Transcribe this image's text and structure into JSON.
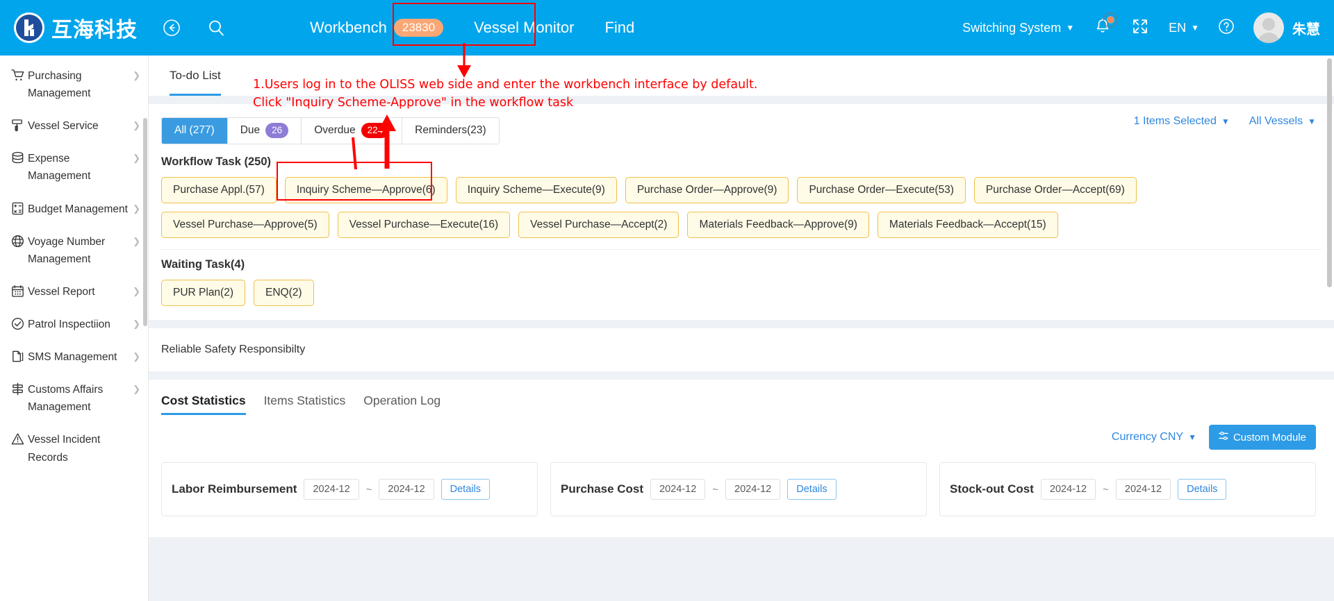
{
  "header": {
    "logo_text": "互海科技",
    "back_icon": "back-arrow-icon",
    "search_icon": "search-icon",
    "nav": [
      {
        "label": "Workbench",
        "badge": "23830",
        "highlighted": true
      },
      {
        "label": "Vessel Monitor",
        "badge": ""
      },
      {
        "label": "Find",
        "badge": ""
      }
    ],
    "switching_system": "Switching System",
    "language": "EN",
    "user_name": "朱慧",
    "notification_icon": "bell-icon",
    "fullscreen_icon": "fullscreen-icon",
    "help_icon": "question-circle-icon"
  },
  "sidebar": {
    "items": [
      {
        "label": "Purchasing Management",
        "icon": "cart-icon"
      },
      {
        "label": "Vessel Service",
        "icon": "paint-roller-icon"
      },
      {
        "label": "Expense Management",
        "icon": "database-icon"
      },
      {
        "label": "Budget Management",
        "icon": "calculator-icon"
      },
      {
        "label": "Voyage Number Management",
        "icon": "globe-icon"
      },
      {
        "label": "Vessel Report",
        "icon": "calendar-icon"
      },
      {
        "label": "Patrol Inspectiion",
        "icon": "check-circle-icon"
      },
      {
        "label": "SMS Management",
        "icon": "documents-icon"
      },
      {
        "label": "Customs Affairs Management",
        "icon": "customs-icon"
      },
      {
        "label": "Vessel Incident Records",
        "icon": "warning-triangle-icon"
      }
    ]
  },
  "main": {
    "todo_tab": "To-do List",
    "filters": [
      {
        "label": "All (277)",
        "pill": "",
        "active": true
      },
      {
        "label": "Due",
        "pill": "26",
        "pill_color": "purple",
        "active": false
      },
      {
        "label": "Overdue",
        "pill": "224",
        "pill_color": "red",
        "active": false
      },
      {
        "label": "Reminders(23)",
        "pill": "",
        "active": false
      }
    ],
    "items_selected": "1 Items Selected",
    "all_vessels": "All Vessels",
    "workflow_title": "Workflow Task (250)",
    "workflow_chips": [
      "Purchase Appl.(57)",
      "Inquiry Scheme—Approve(6)",
      "Inquiry Scheme—Execute(9)",
      "Purchase Order—Approve(9)",
      "Purchase Order—Execute(53)",
      "Purchase Order—Accept(69)",
      "Vessel Purchase—Approve(5)",
      "Vessel Purchase—Execute(16)",
      "Vessel Purchase—Accept(2)",
      "Materials Feedback—Approve(9)",
      "Materials Feedback—Accept(15)"
    ],
    "waiting_title": "Waiting Task(4)",
    "waiting_chips": [
      "PUR Plan(2)",
      "ENQ(2)"
    ],
    "reliable_safety": "Reliable Safety Responsibilty",
    "stat_tabs": [
      {
        "label": "Cost Statistics",
        "active": true
      },
      {
        "label": "Items Statistics",
        "active": false
      },
      {
        "label": "Operation Log",
        "active": false
      }
    ],
    "currency": "Currency CNY",
    "custom_module": "Custom Module",
    "cards": [
      {
        "title": "Labor Reimbursement",
        "date_from": "2024-12",
        "date_to": "2024-12",
        "details": "Details"
      },
      {
        "title": "Purchase Cost",
        "date_from": "2024-12",
        "date_to": "2024-12",
        "details": "Details"
      },
      {
        "title": "Stock-out Cost",
        "date_from": "2024-12",
        "date_to": "2024-12",
        "details": "Details"
      }
    ]
  },
  "annotations": {
    "line1": "1.Users log in to the OLISS web side and enter the workbench interface by default.",
    "line2": "Click \"Inquiry Scheme-Approve\" in the workflow task",
    "color": "#FF0000"
  }
}
